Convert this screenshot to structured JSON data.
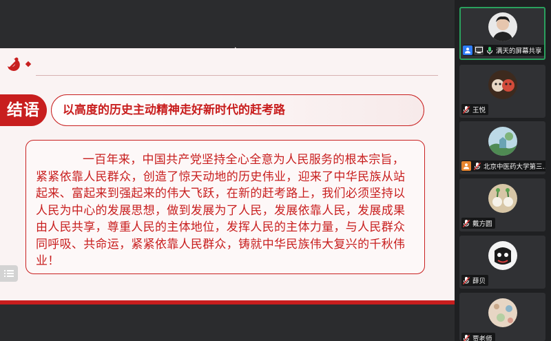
{
  "slide": {
    "section_tag": "结语",
    "section_title": "以高度的历史主动精神走好新时代的赶考路",
    "body": "一百年来，中国共产党坚持全心全意为人民服务的根本宗旨，紧紧依靠人民群众，创造了惊天动地的历史伟业，迎来了中华民族从站起来、富起来到强起来的伟大飞跃，在新的赶考路上，我们必须坚持以人民为中心的发展思想，做到发展为了人民，发展依靠人民，发展成果由人民共享，尊重人民的主体地位，发挥人民的主体力量，与人民群众同呼吸、共命运，紧紧依靠人民群众，铸就中华民族伟大复兴的千秋伟业！"
  },
  "participants": [
    {
      "name": "满天的屏幕共享",
      "icons": [
        "user-icon",
        "screen-share-icon",
        "mic-icon"
      ],
      "active": true
    },
    {
      "name": "王悦",
      "icons": [
        "mic-off-icon"
      ],
      "active": false
    },
    {
      "name": "北京中医药大学第三…",
      "icons": [
        "host-icon",
        "mic-off-icon"
      ],
      "active": false
    },
    {
      "name": "戴方圆",
      "icons": [
        "mic-off-icon"
      ],
      "active": false
    },
    {
      "name": "薛贝",
      "icons": [
        "mic-off-icon"
      ],
      "active": false
    },
    {
      "name": "贾老师",
      "icons": [
        "mic-off-icon"
      ],
      "active": false
    }
  ],
  "colors": {
    "accent": "#c81e1e",
    "active_border": "#2aa15e",
    "slide_bg": "#faf3f3"
  }
}
